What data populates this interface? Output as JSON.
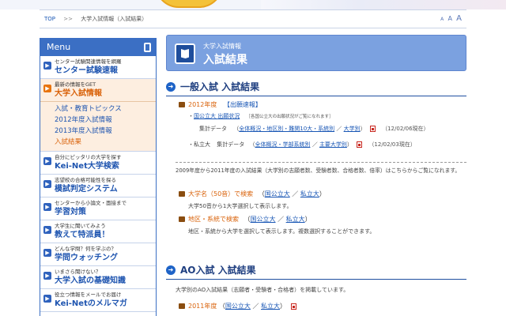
{
  "breadcrumb": {
    "home": "TOP",
    "separator": ">>",
    "current": "大学入試情報（入試結果）",
    "fontsize": [
      "A",
      "A",
      "A"
    ]
  },
  "menu": {
    "title": "Menu",
    "items": [
      {
        "small": "センター試験関連情報を網羅",
        "big": "センター試験速報",
        "active": false
      },
      {
        "small": "最新の情報をGET",
        "big": "大学入試情報",
        "active": true
      },
      {
        "small": "自分にピッタリの大学を探す",
        "big": "Kei-Net大学検索",
        "active": false
      },
      {
        "small": "志望校の合格可能性を探る",
        "big": "模試判定システム",
        "active": false
      },
      {
        "small": "センターから小論文・面接まで",
        "big": "学習対策",
        "active": false
      },
      {
        "small": "大学生に聞いてみよう",
        "big": "教えて特派員！",
        "active": false
      },
      {
        "small": "どんな学問？何を学ぶの？",
        "big": "学問ウォッチング",
        "active": false
      },
      {
        "small": "いまさら聞けない？",
        "big": "大学入試の基礎知識",
        "active": false
      },
      {
        "small": "役立つ情報をメールでお届け",
        "big": "Kei-Netのメルマガ",
        "active": false
      }
    ],
    "subitems": [
      "入試・教育トピックス",
      "2012年度入試情報",
      "2013年度入試情報",
      "入試結果"
    ]
  },
  "banner": {
    "small": "大学入試情報",
    "big": "入試結果"
  },
  "general": {
    "heading": "一般入試 入試結果",
    "year_label": "2012年度",
    "bracket": "【出願速報】",
    "national_label": "国公立大",
    "national_status": "出願状況",
    "national_note": "［各国公立大の出願状況がご覧になれます］",
    "summary_label": "集計データ",
    "link_a": "全体概況・地区別・難関10大・系統別",
    "link_b": "大学別",
    "date_a": "（12/02/06現在）",
    "private_label": "私立大",
    "link_c": "全体概況・学部系統別",
    "link_d": "主要大学別",
    "date_b": "（12/02/03現在）",
    "intro": "2009年度から2011年度の入試結果（大学別の志願者数、受験者数、合格者数、倍率）はこちらからご覧になれます。",
    "search1": "大学名（50音）で検索",
    "search1_desc": "大学50音から1大学選択して表示します。",
    "search2": "地区・系統で検索",
    "search2_desc": "地区・系統から大学を選択して表示します。複数選択することができます。",
    "nat": "国公立大",
    "priv": "私立大"
  },
  "ao": {
    "heading": "AO入試 入試結果",
    "intro": "大学別のAO入試結果（志願者・受験者・合格者）を掲載しています。",
    "year_label": "2011年度",
    "nat": "国公立大",
    "priv": "私立大"
  }
}
